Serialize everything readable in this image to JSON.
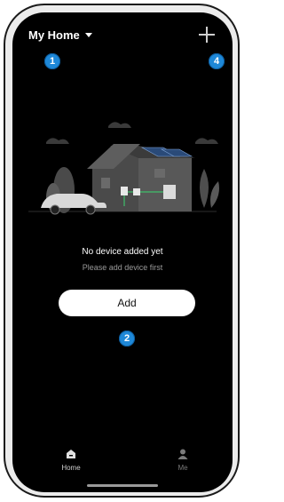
{
  "header": {
    "home_name": "My Home"
  },
  "badges": {
    "one": "1",
    "two": "2",
    "four": "4"
  },
  "empty_state": {
    "title": "No device added yet",
    "subtitle": "Please add device first"
  },
  "actions": {
    "add_label": "Add"
  },
  "tabbar": {
    "home_label": "Home",
    "me_label": "Me"
  },
  "colors": {
    "screen_bg": "#000000",
    "badge_blue": "#1e88d8",
    "button_bg": "#ffffff"
  },
  "icons": {
    "dropdown": "chevron-down-icon",
    "add": "plus-icon",
    "home_tab": "home-icon",
    "me_tab": "user-icon",
    "empty_illustration": "house-solar-illustration"
  }
}
